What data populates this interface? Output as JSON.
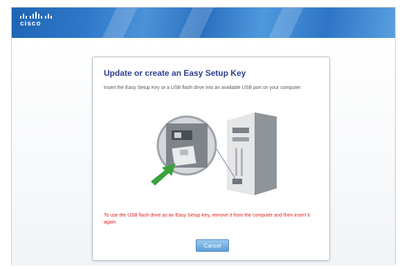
{
  "brand": {
    "logo_text": "cisco"
  },
  "dialog": {
    "title": "Update or create an Easy Setup Key",
    "instruction": "Insert the Easy Setup Key or a USB flash drive into an available USB port on your computer.",
    "warning": "To use the USB flash drive as an Easy Setup Key, remove it from the computer and then insert it again.",
    "cancel_label": "Cancel"
  },
  "colors": {
    "banner": "#2f79c9",
    "title": "#2e3d8f",
    "warning": "#e02020",
    "arrow": "#3aa33a",
    "button": "#5a9ed9"
  },
  "icons": {
    "illustration": "usb-drive-into-computer-illustration",
    "arrow": "green-arrow-icon"
  }
}
